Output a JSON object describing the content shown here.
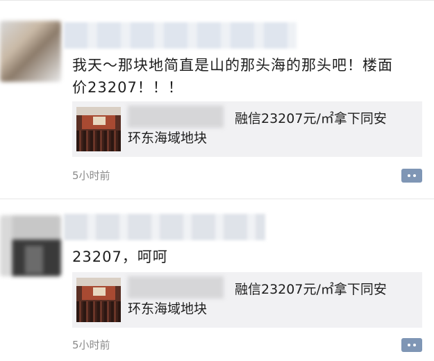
{
  "posts": [
    {
      "comment": "我天～那块地简直是山的那头海的那头吧！楼面价23207！！！",
      "share": {
        "title_line1": "融信23207元/㎡拿下同安",
        "title_line2": "环东海域地块",
        "thumbnail_icon": "conference-hall-photo"
      },
      "timestamp": "5小时前",
      "action_icon": "comment-icon"
    },
    {
      "comment": "23207，呵呵",
      "share": {
        "title_line1": "融信23207元/㎡拿下同安",
        "title_line2": "环东海域地块",
        "thumbnail_icon": "conference-hall-photo"
      },
      "timestamp": "5小时前",
      "action_icon": "comment-icon"
    }
  ],
  "colors": {
    "comment_button": "#7f96b5",
    "card_background": "#f1f1f3",
    "timestamp": "#8a8a8a"
  }
}
